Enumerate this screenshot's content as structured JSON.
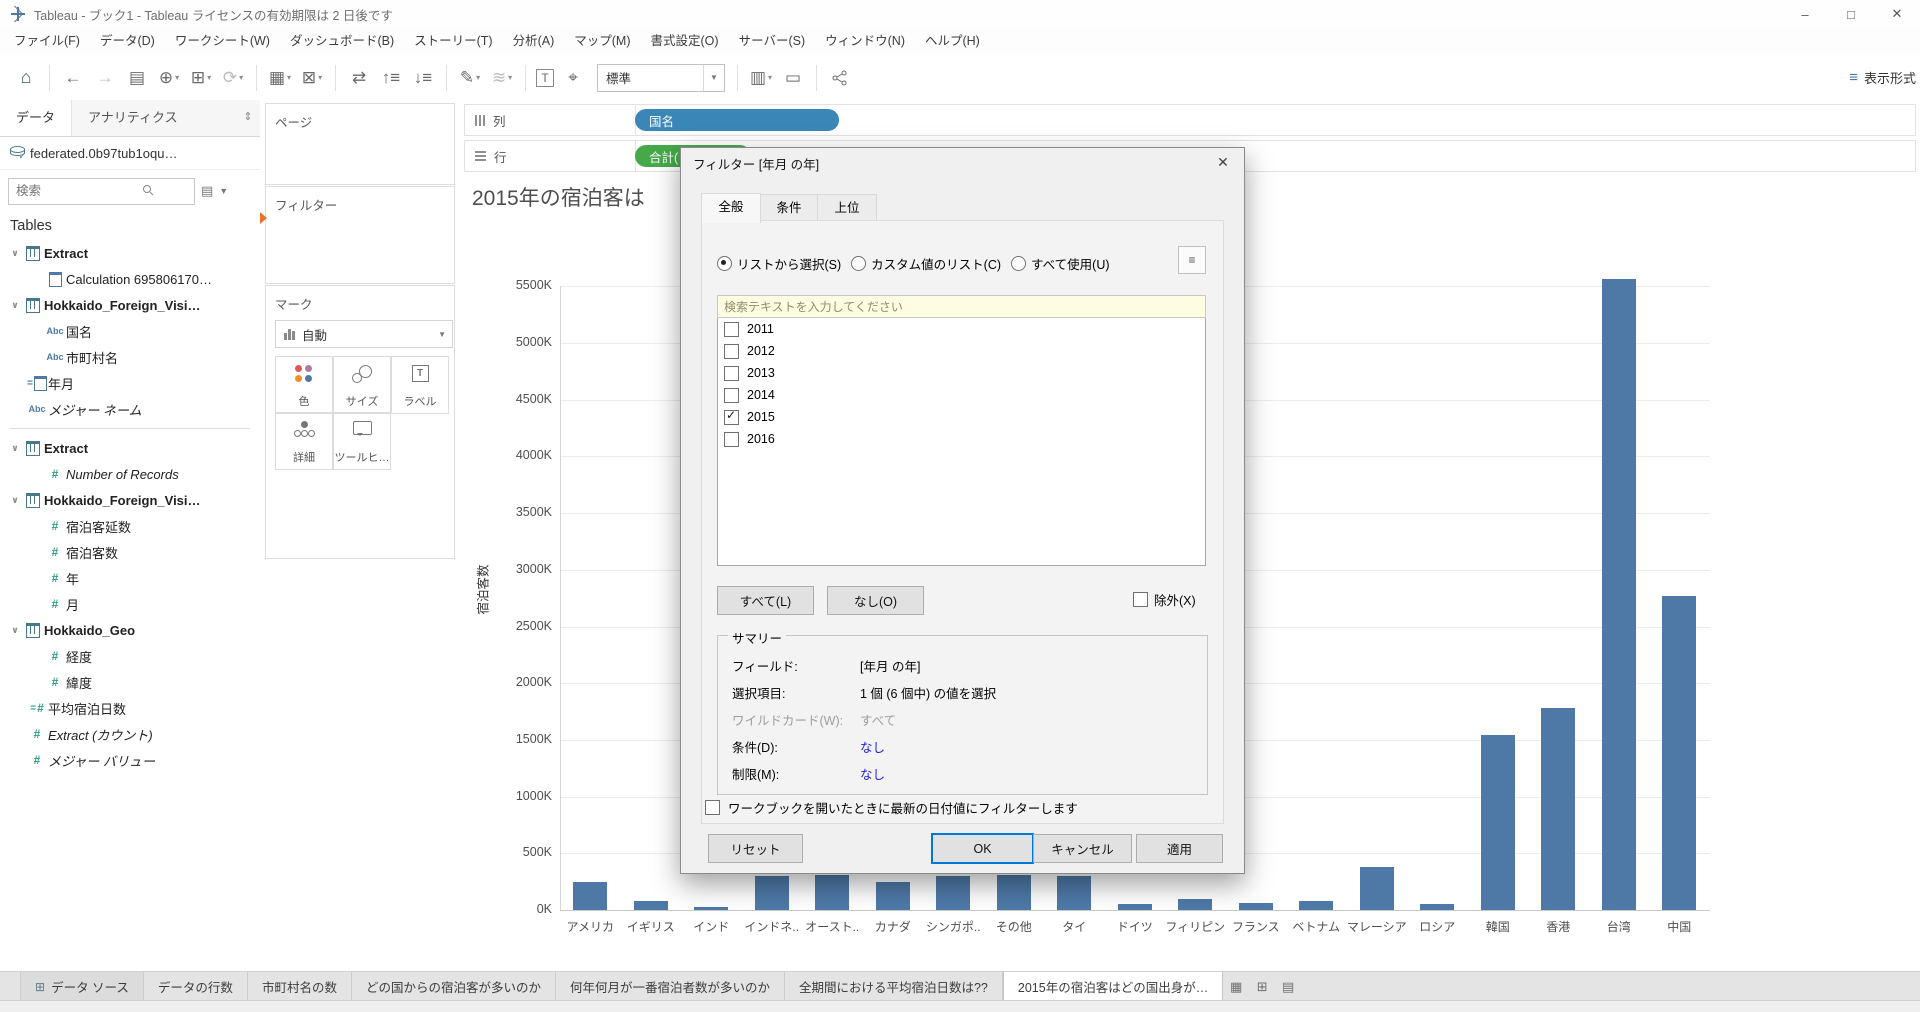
{
  "window": {
    "title": "Tableau - ブック1 - Tableau ライセンスの有効期限は 2 日後です",
    "minimize": "–",
    "maximize": "□",
    "close": "✕"
  },
  "menu": {
    "items": [
      "ファイル(F)",
      "データ(D)",
      "ワークシート(W)",
      "ダッシュボード(B)",
      "ストーリー(T)",
      "分析(A)",
      "マップ(M)",
      "書式設定(O)",
      "サーバー(S)",
      "ウィンドウ(N)",
      "ヘルプ(H)"
    ]
  },
  "toolbar": {
    "fit_selector": "標準",
    "show_me_label": "表示形式"
  },
  "sidebar": {
    "tabs": [
      {
        "label": "データ",
        "active": true
      },
      {
        "label": "アナリティクス",
        "active": false
      }
    ],
    "datasource": "federated.0b97tub1oqu…",
    "search_placeholder": "検索",
    "tables_label": "Tables",
    "fields": [
      {
        "label": "Extract",
        "icon": "table",
        "bold": true,
        "caret": true,
        "indent": 0
      },
      {
        "label": "Calculation 695806170…",
        "icon": "date",
        "indent": 1
      },
      {
        "label": "Hokkaido_Foreign_Visi…",
        "icon": "table",
        "bold": true,
        "caret": true,
        "indent": 0
      },
      {
        "label": "国名",
        "icon": "abc",
        "indent": 1
      },
      {
        "label": "市町村名",
        "icon": "abc",
        "indent": 1
      },
      {
        "label": "年月",
        "icon": "calc-date",
        "indent": 0.5
      },
      {
        "label": "メジャー ネーム",
        "icon": "abc",
        "indent": 0.5,
        "italic": true
      },
      {
        "divider": true
      },
      {
        "label": "Extract",
        "icon": "table",
        "bold": true,
        "caret": true,
        "indent": 0
      },
      {
        "label": "Number of Records",
        "icon": "num",
        "indent": 1,
        "italic": true
      },
      {
        "label": "Hokkaido_Foreign_Visi…",
        "icon": "table",
        "bold": true,
        "caret": true,
        "indent": 0
      },
      {
        "label": "宿泊客延数",
        "icon": "num",
        "indent": 1
      },
      {
        "label": "宿泊客数",
        "icon": "num",
        "indent": 1
      },
      {
        "label": "年",
        "icon": "num",
        "indent": 1
      },
      {
        "label": "月",
        "icon": "num",
        "indent": 1
      },
      {
        "label": "Hokkaido_Geo",
        "icon": "table",
        "bold": true,
        "caret": true,
        "indent": 0
      },
      {
        "label": "経度",
        "icon": "num",
        "indent": 1
      },
      {
        "label": "緯度",
        "icon": "num",
        "indent": 1
      },
      {
        "label": "平均宿泊日数",
        "icon": "calc-num",
        "indent": 0.5
      },
      {
        "label": "Extract (カウント)",
        "icon": "num",
        "indent": 0.5,
        "italic": true
      },
      {
        "label": "メジャー バリュー",
        "icon": "num",
        "indent": 0.5,
        "italic": true
      }
    ]
  },
  "cards": {
    "pages_label": "ページ",
    "filters_label": "フィルター",
    "marks_label": "マーク",
    "mark_type": "自動",
    "color_label": "色",
    "size_label": "サイズ",
    "label_label": "ラベル",
    "detail_label": "詳細",
    "tooltip_label": "ツールヒ…"
  },
  "shelves": {
    "columns_label": "列",
    "rows_label": "行",
    "columns_pill": "国名",
    "rows_pill": "合計("
  },
  "sheet": {
    "title": "2015年の宿泊客は"
  },
  "chart_data": {
    "type": "bar",
    "title": "2015年の宿泊客は (ダイアログで一部隠れた棒グラフ)",
    "ylabel": "宿泊客数",
    "xlabel": "",
    "categories": [
      "アメリカ",
      "イギリス",
      "インド",
      "インドネ..",
      "オースト..",
      "カナダ",
      "シンガポ..",
      "その他",
      "タイ",
      "ドイツ",
      "フィリピン",
      "フランス",
      "ベトナム",
      "マレーシア",
      "ロシア",
      "韓国",
      "香港",
      "台湾",
      "中国"
    ],
    "values_thousands": [
      245,
      80,
      25,
      300,
      305,
      250,
      300,
      310,
      300,
      55,
      100,
      60,
      75,
      380,
      50,
      1540,
      1780,
      5560,
      2770
    ],
    "yticks": [
      "0K",
      "500K",
      "1000K",
      "1500K",
      "2000K",
      "2500K",
      "3000K",
      "3500K",
      "4000K",
      "4500K",
      "5000K",
      "5500K"
    ],
    "ylim": [
      0,
      5700
    ],
    "bar_color": "#4e79a7",
    "grid": true,
    "legend": "none"
  },
  "dialog": {
    "title": "フィルター [年月 の年]",
    "close": "✕",
    "tabs": [
      {
        "label": "全般",
        "active": true
      },
      {
        "label": "条件",
        "active": false
      },
      {
        "label": "上位",
        "active": false
      }
    ],
    "radios": [
      {
        "label": "リストから選択(S)",
        "selected": true
      },
      {
        "label": "カスタム値のリスト(C)",
        "selected": false
      },
      {
        "label": "すべて使用(U)",
        "selected": false
      }
    ],
    "search_placeholder": "検索テキストを入力してください",
    "list": [
      {
        "label": "2011",
        "checked": false
      },
      {
        "label": "2012",
        "checked": false
      },
      {
        "label": "2013",
        "checked": false
      },
      {
        "label": "2014",
        "checked": false
      },
      {
        "label": "2015",
        "checked": true
      },
      {
        "label": "2016",
        "checked": false
      }
    ],
    "select_all": "すべて(L)",
    "select_none": "なし(O)",
    "exclude": "除外(X)",
    "summary": {
      "title": "サマリー",
      "rows": [
        {
          "label": "フィールド:",
          "value": "[年月 の年]",
          "style": "normal"
        },
        {
          "label": "選択項目:",
          "value": "1 個 (6 個中) の値を選択",
          "style": "normal"
        },
        {
          "label": "ワイルドカード(W):",
          "value": "すべて",
          "style": "disabled"
        },
        {
          "label": "条件(D):",
          "value": "なし",
          "style": "link"
        },
        {
          "label": "制限(M):",
          "value": "なし",
          "style": "link"
        }
      ]
    },
    "latest_date_label": "ワークブックを開いたときに最新の日付値にフィルターします",
    "buttons": {
      "reset": "リセット",
      "ok": "OK",
      "cancel": "キャンセル",
      "apply": "適用"
    }
  },
  "bottom_tabs": {
    "datasource_tab": "データ ソース",
    "sheets": [
      {
        "label": "データの行数",
        "active": false
      },
      {
        "label": "市町村名の数",
        "active": false
      },
      {
        "label": "どの国からの宿泊客が多いのか",
        "active": false
      },
      {
        "label": "何年何月が一番宿泊者数が多いのか",
        "active": false
      },
      {
        "label": "全期間における平均宿泊日数は??",
        "active": false
      },
      {
        "label": "2015年の宿泊客はどの国出身が…",
        "active": true
      }
    ]
  }
}
